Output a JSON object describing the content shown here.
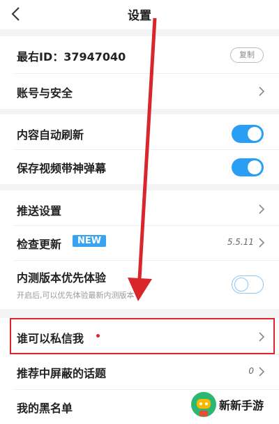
{
  "header": {
    "title": "设置"
  },
  "account": {
    "id_label": "最右ID：37947040",
    "copy_label": "复制",
    "security_label": "账号与安全"
  },
  "content": {
    "auto_refresh_label": "内容自动刷新",
    "auto_refresh_on": true,
    "save_danmaku_label": "保存视频带神弹幕",
    "save_danmaku_on": true
  },
  "misc": {
    "push_label": "推送设置",
    "update_label": "检查更新",
    "new_badge": "NEW",
    "version": "5.5.11",
    "beta_label": "内测版本优先体验",
    "beta_desc": "开启后,可以优先体验最新内测版本",
    "beta_on": false
  },
  "privacy": {
    "who_can_message_label": "谁可以私信我",
    "blocked_topics_label": "推荐中屏蔽的话题",
    "blocked_topics_count": "0",
    "blacklist_label": "我的黑名单"
  },
  "watermark": {
    "text": "新新手游"
  },
  "colors": {
    "accent": "#2a9df4",
    "highlight": "#d9262c",
    "background": "#f3f3f5"
  }
}
